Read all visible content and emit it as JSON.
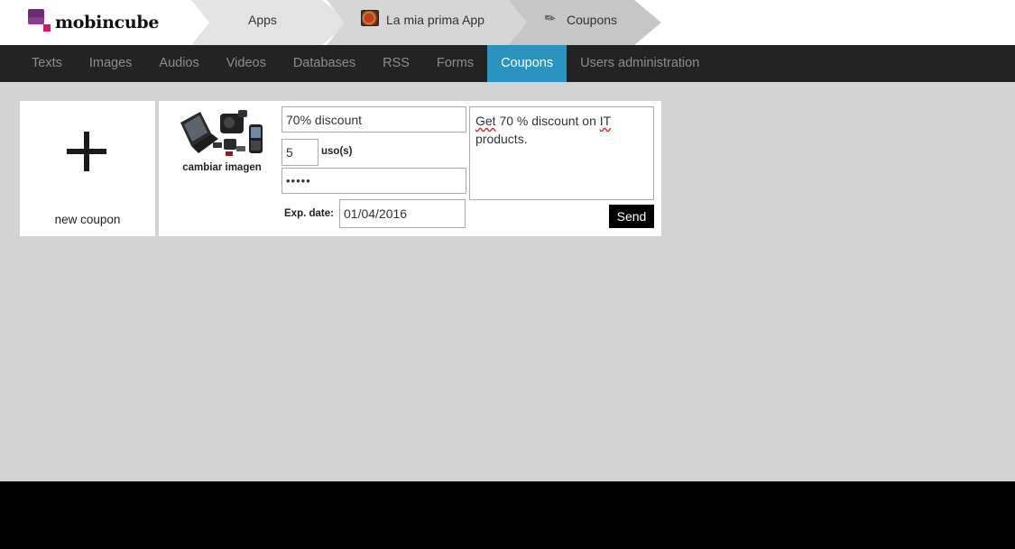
{
  "brand": {
    "name": "mobincube"
  },
  "breadcrumbs": {
    "apps": "Apps",
    "app": "La mia prima App",
    "section": "Coupons"
  },
  "nav": {
    "items": [
      "Texts",
      "Images",
      "Audios",
      "Videos",
      "Databases",
      "RSS",
      "Forms",
      "Coupons",
      "Users administration"
    ],
    "active": "Coupons",
    "active_color": "#2a93c0"
  },
  "new_coupon": {
    "label": "new coupon"
  },
  "coupon": {
    "title": "70% discount",
    "uses": "5",
    "uses_label": "uso(s)",
    "code": "•••••",
    "exp_label": "Exp. date:",
    "exp_date": "01/04/2016",
    "description_parts": [
      "Get",
      " 70 % discount on ",
      "IT",
      " products."
    ],
    "change_image_label": "cambiar imagen",
    "send_label": "Send"
  }
}
